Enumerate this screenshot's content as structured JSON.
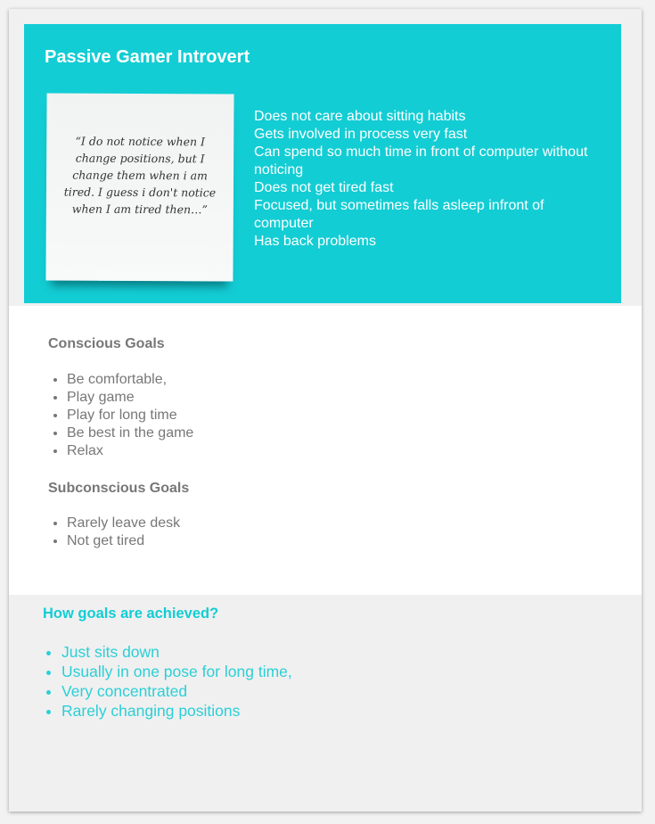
{
  "persona": {
    "title": "Passive Gamer Introvert",
    "quote": "“I do not notice when I change positions, but I change them when i am tired. I guess i don't notice when I am tired then…”",
    "traits": [
      "Does not care about sitting habits",
      "Gets involved in process very fast",
      "Can spend so much time in front of computer without noticing",
      "Does not get tired fast",
      "Focused, but sometimes falls asleep infront of computer",
      "Has back problems"
    ]
  },
  "conscious": {
    "heading": "Conscious Goals",
    "items": [
      "Be comfortable,",
      "Play game",
      "Play for long time",
      "Be best in the game",
      "Relax"
    ]
  },
  "subconscious": {
    "heading": "Subconscious Goals",
    "items": [
      "Rarely leave desk",
      "Not get tired"
    ]
  },
  "achieve": {
    "heading": "How  goals are achieved?",
    "items": [
      "Just sits down",
      "Usually in one pose for long time,",
      "Very concentrated",
      "Rarely changing positions"
    ]
  }
}
